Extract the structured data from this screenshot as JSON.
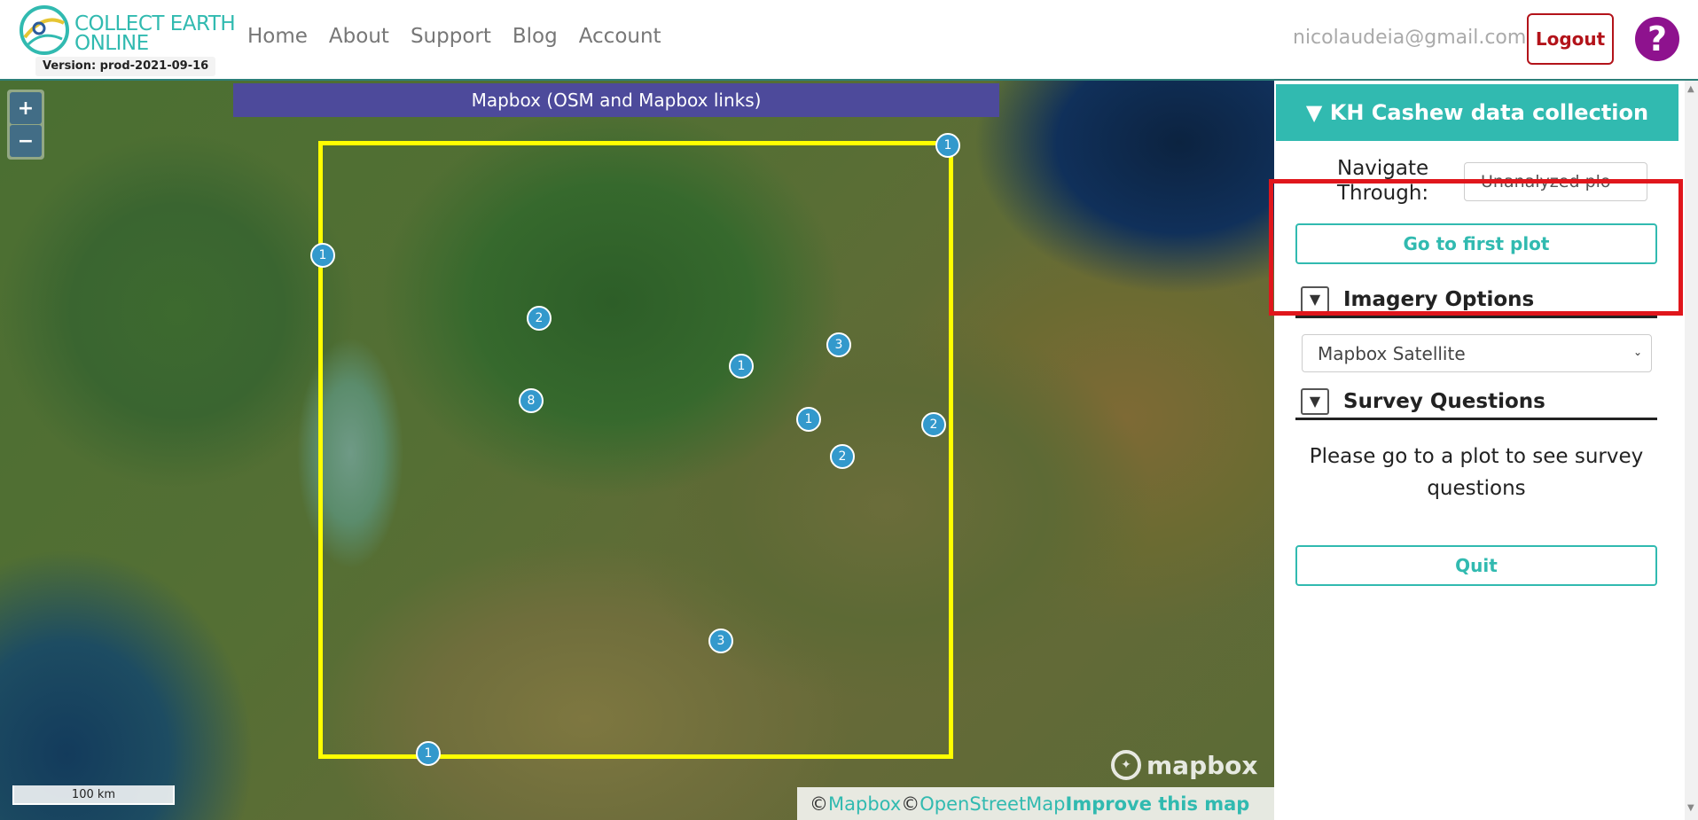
{
  "navbar": {
    "logo_line1": "COLLECT EARTH",
    "logo_line2": "ONLINE",
    "version": "Version: prod-2021-09-16",
    "links": [
      "Home",
      "About",
      "Support",
      "Blog",
      "Account"
    ],
    "user_email": "nicolaudeia@gmail.com",
    "logout_label": "Logout",
    "help_label": "?"
  },
  "map": {
    "basemap_title": "Mapbox (OSM and Mapbox links)",
    "zoom_in": "+",
    "zoom_out": "−",
    "scale_label": "100 km",
    "mapbox_logo": "mapbox",
    "attribution": {
      "copyright1": "© ",
      "mapbox_link": "Mapbox",
      "copyright2": "© ",
      "osm_link": "OpenStreetMap",
      "improve_link": "Improve this map"
    },
    "markers": [
      "1",
      "1",
      "2",
      "8",
      "1",
      "3",
      "1",
      "2",
      "2",
      "3",
      "1"
    ]
  },
  "sidebar": {
    "project_title": "▼ KH Cashew data collection",
    "navigate_label": "Navigate Through:",
    "navigate_value": "Unanalyzed plo",
    "first_plot_label": "Go to first plot",
    "imagery_toggle": "▼",
    "imagery_title": "Imagery Options",
    "imagery_value": "Mapbox Satellite",
    "survey_toggle": "▼",
    "survey_title": "Survey Questions",
    "survey_message": "Please go to a plot to see survey questions",
    "quit_label": "Quit"
  },
  "colors": {
    "teal": "#31bab0",
    "logout_red": "#b3131a",
    "help_purple": "#8e128e",
    "basemap_title_bg": "#4d4a9b",
    "aoi_yellow": "#ffff00",
    "marker_blue": "#3399cc",
    "highlight_red": "#e0161c"
  }
}
